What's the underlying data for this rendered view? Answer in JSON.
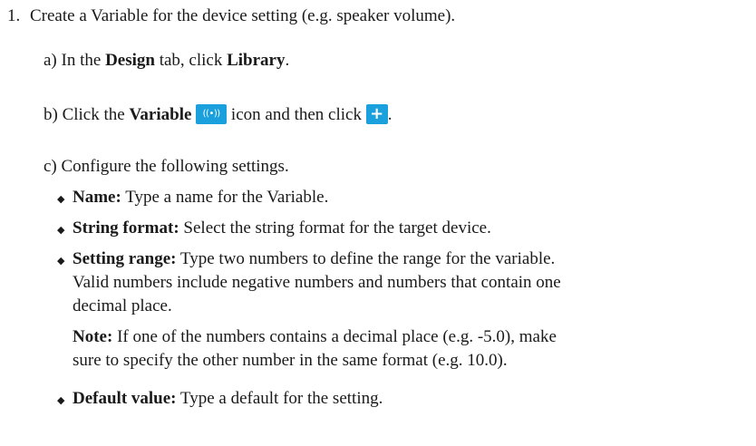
{
  "step": {
    "number": "1.",
    "title": "Create a Variable for the device setting (e.g. speaker volume)."
  },
  "substeps": {
    "a": {
      "label": "a) In the ",
      "bold1": "Design",
      "mid": " tab, click ",
      "bold2": "Library",
      "end": "."
    },
    "b": {
      "label": "b) Click the ",
      "bold1": "Variable",
      "mid": " icon and then click ",
      "end": "."
    },
    "c": {
      "text": "c) Configure the following settings."
    }
  },
  "icons": {
    "variable": {
      "name": "variable-icon",
      "glyph": "((•))",
      "color": "#1aa0dc"
    },
    "plus": {
      "name": "plus-icon",
      "glyph": "+",
      "color": "#1aa0dc"
    },
    "bullet": "◆"
  },
  "settings": [
    {
      "term": "Name:",
      "desc": " Type a name for the Variable."
    },
    {
      "term": "String format:",
      "desc": " Select the string format for the target device."
    },
    {
      "term": "Setting range:",
      "desc1": " Type two numbers to define the range for the variable.",
      "desc2": "Valid numbers include negative numbers and numbers that contain one",
      "desc3": "decimal place.",
      "note_term": "Note:",
      "note1": " If one of the numbers contains a decimal place (e.g. -5.0), make",
      "note2": "sure to specify the other number in the same format (e.g. 10.0)."
    },
    {
      "term": "Default value:",
      "desc": " Type a default for the setting."
    }
  ]
}
